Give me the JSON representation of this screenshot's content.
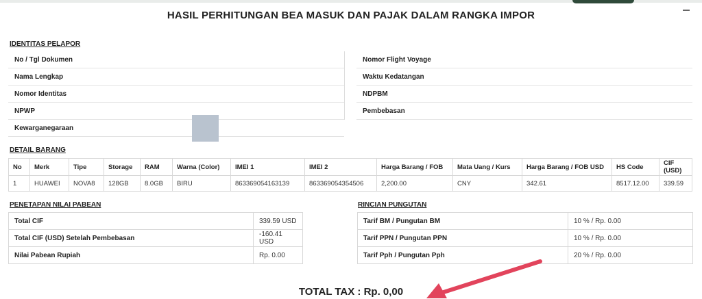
{
  "title": "HASIL PERHITUNGAN BEA MASUK DAN PAJAK DALAM RANGKA IMPOR",
  "identitas": {
    "heading": "IDENTITAS PELAPOR",
    "left_fields": [
      "No / Tgl Dokumen",
      "Nama Lengkap",
      "Nomor Identitas",
      "NPWP",
      "Kewarganegaraan"
    ],
    "right_fields": [
      "Nomor Flight Voyage",
      "Waktu Kedatangan",
      "NDPBM",
      "Pembebasan"
    ]
  },
  "detail": {
    "heading": "DETAIL BARANG",
    "columns": [
      "No",
      "Merk",
      "Tipe",
      "Storage",
      "RAM",
      "Warna (Color)",
      "IMEI 1",
      "IMEI 2",
      "Harga Barang / FOB",
      "Mata Uang / Kurs",
      "Harga Barang / FOB USD",
      "HS Code",
      "CIF (USD)"
    ],
    "rows": [
      [
        "1",
        "HUAWEI",
        "NOVA8",
        "128GB",
        "8.0GB",
        "BIRU",
        "863369054163139",
        "863369054354506",
        "2,200.00",
        "CNY",
        "342.61",
        "8517.12.00",
        "339.59"
      ]
    ]
  },
  "penetapan": {
    "heading": "PENETAPAN NILAI PABEAN",
    "rows": [
      {
        "label": "Total CIF",
        "value": "339.59 USD"
      },
      {
        "label": "Total CIF (USD) Setelah Pembebasan",
        "value": "-160.41 USD"
      },
      {
        "label": "Nilai Pabean Rupiah",
        "value": "Rp. 0.00"
      }
    ]
  },
  "rincian": {
    "heading": "RINCIAN PUNGUTAN",
    "rows": [
      {
        "label": "Tarif BM / Pungutan BM",
        "value": "10 % / Rp. 0.00"
      },
      {
        "label": "Tarif PPN / Pungutan PPN",
        "value": "10 % / Rp. 0.00"
      },
      {
        "label": "Tarif Pph / Pungutan Pph",
        "value": "20 % / Rp. 0.00"
      }
    ]
  },
  "total_tax": "TOTAL TAX : Rp. 0,00",
  "colors": {
    "arrow": "#e2445c",
    "border": "#d8d8d8",
    "photo": "#b9c3cf"
  }
}
